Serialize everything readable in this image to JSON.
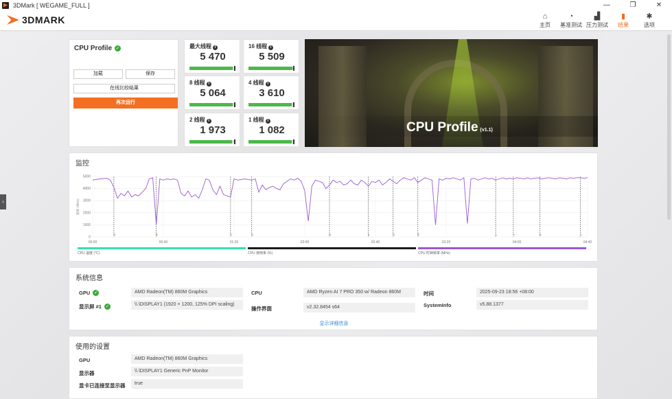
{
  "window": {
    "title": "3DMark [ WEGAME_FULL ]",
    "minimize": "—",
    "maximize": "❐",
    "close": "✕"
  },
  "app": {
    "logo": "3DMARK"
  },
  "nav": [
    {
      "label": "主页",
      "icon": "⌂"
    },
    {
      "label": "基准测试",
      "icon": "◔"
    },
    {
      "label": "压力测试",
      "icon": "▟"
    },
    {
      "label": "结果",
      "icon": "▮"
    },
    {
      "label": "选项",
      "icon": "✱"
    }
  ],
  "cpu_card": {
    "title": "CPU Profile",
    "load": "加载",
    "save": "保存",
    "compare": "在线比较结果",
    "rerun": "再次运行"
  },
  "scores": [
    {
      "label": "最大线程",
      "value": "5 470",
      "fill": 0.96
    },
    {
      "label": "16 线程",
      "value": "5 509",
      "fill": 0.97
    },
    {
      "label": "8 线程",
      "value": "5 064",
      "fill": 0.95
    },
    {
      "label": "4 线程",
      "value": "3 610",
      "fill": 0.96
    },
    {
      "label": "2 线程",
      "value": "1 973",
      "fill": 0.94
    },
    {
      "label": "1 线程",
      "value": "1 082",
      "fill": 0.95
    }
  ],
  "hero": {
    "title": "CPU Profile",
    "version": "(v1.1)"
  },
  "monitor": {
    "title": "监控",
    "legend": [
      "CPU 温度 (°C)",
      "CPU 使用率 (%)",
      "CPU 时钟频率 (MHz)"
    ],
    "legend_colors": [
      "#35e0b0",
      "#1b1b1b",
      "#9b59d0"
    ]
  },
  "chart_data": {
    "type": "line",
    "ylabel": "频率 (MHz)",
    "ylim": [
      0,
      5000
    ],
    "yticks": [
      "5000",
      "4000",
      "3000",
      "2000",
      "1000",
      "0"
    ],
    "xticks": [
      "00:00",
      "00:40",
      "01:20",
      "02:00",
      "02:40",
      "03:20",
      "04:00",
      "04:40"
    ],
    "xlim": [
      0,
      280
    ],
    "series": [
      {
        "name": "CPU 时钟频率 (MHz)",
        "x": [
          0,
          4,
          8,
          10,
          12,
          14,
          16,
          18,
          20,
          22,
          24,
          26,
          28,
          30,
          32,
          34,
          36,
          38,
          40,
          42,
          44,
          46,
          48,
          50,
          52,
          54,
          56,
          58,
          60,
          62,
          64,
          66,
          68,
          70,
          72,
          74,
          76,
          78,
          80,
          82,
          84,
          86,
          88,
          90,
          92,
          94,
          96,
          98,
          100,
          102,
          104,
          106,
          108,
          110,
          112,
          114,
          116,
          118,
          120,
          122,
          124,
          126,
          128,
          130,
          132,
          134,
          136,
          138,
          140,
          142,
          144,
          146,
          148,
          150,
          152,
          154,
          156,
          158,
          160,
          162,
          164,
          166,
          168,
          170,
          172,
          174,
          176,
          178,
          180,
          182,
          184,
          186,
          188,
          190,
          192,
          194,
          196,
          198,
          200,
          202,
          204,
          206,
          208,
          210,
          212,
          214,
          216,
          218,
          220,
          222,
          224,
          226,
          228,
          230,
          232,
          234,
          236,
          238,
          240,
          242,
          244,
          246,
          248,
          250,
          252,
          254,
          256,
          258,
          260,
          262,
          264,
          266,
          268,
          270,
          272,
          274,
          276,
          278,
          280
        ],
        "y": [
          4700,
          4800,
          4850,
          4700,
          4100,
          3200,
          3600,
          3400,
          3800,
          3300,
          3500,
          3400,
          3700,
          4000,
          4800,
          4900,
          1000,
          4800,
          4700,
          4800,
          4750,
          4800,
          4700,
          3600,
          3400,
          3800,
          3300,
          3500,
          3200,
          3900,
          4800,
          4700,
          3900,
          3500,
          4200,
          3500,
          3400,
          3300,
          4800,
          4700,
          4750,
          4800,
          4750,
          4700,
          4800,
          3700,
          4300,
          3900,
          4100,
          4200,
          4000,
          3900,
          4400,
          4600,
          4800,
          4700,
          4850,
          4600,
          3800,
          1300,
          4200,
          4700,
          4600,
          4500,
          4000,
          4300,
          4700,
          4500,
          4600,
          4300,
          4400,
          4700,
          4400,
          4300,
          4700,
          4500,
          4200,
          4600,
          4500,
          4700,
          4300,
          4500,
          4800,
          4600,
          4400,
          4700,
          4900,
          4800,
          4700,
          4900,
          4500,
          4700,
          4900,
          4800,
          4700,
          1000,
          4800,
          4700,
          4850,
          4800,
          4900,
          4800,
          4700,
          4900,
          1100,
          4800,
          4850,
          4700,
          4800,
          4900,
          4800,
          4850,
          4700,
          4800,
          4900,
          4800,
          4850,
          4800,
          4900,
          4850,
          4800,
          4900,
          4800,
          4850,
          4900,
          4800,
          4850,
          4900,
          4850,
          4800,
          4900,
          4850,
          4800,
          4900,
          4850,
          4900,
          4900,
          4850,
          4900
        ]
      }
    ],
    "markers": [
      12,
      36,
      78,
      90,
      134,
      156,
      170,
      184,
      228,
      238,
      253,
      276
    ],
    "marker_labels": [
      "A",
      "B",
      "C",
      "D",
      "E",
      "F",
      "G",
      "H",
      "I",
      "J",
      "K",
      "L"
    ]
  },
  "sysinfo": {
    "title": "系统信息",
    "gpu_label": "GPU",
    "gpu": "AMD Radeon(TM) 860M Graphics",
    "display_label": "显示屏 #1",
    "display": "\\\\.\\DISPLAY1 (1920 × 1200, 125% DPI scaling)",
    "cpu_label": "CPU",
    "cpu": "AMD Ryzen AI 7 PRO 350 w/ Radeon 860M",
    "os_label": "操作界面",
    "os": "v2.32.8454 s64",
    "time_label": "时间",
    "time": "2025-09-23 18:56 +08:00",
    "si_label": "SystemInfo",
    "si": "v5.88.1377",
    "details": "显示详细信息"
  },
  "settings": {
    "title": "使用的设置",
    "gpu_label": "GPU",
    "gpu": "AMD Radeon(TM) 860M Graphics",
    "display_label": "显示器",
    "display": "\\\\.\\DISPLAY1 Generic PnP Monitor",
    "connected_label": "显卡已连接至显示器",
    "connected": "true"
  }
}
